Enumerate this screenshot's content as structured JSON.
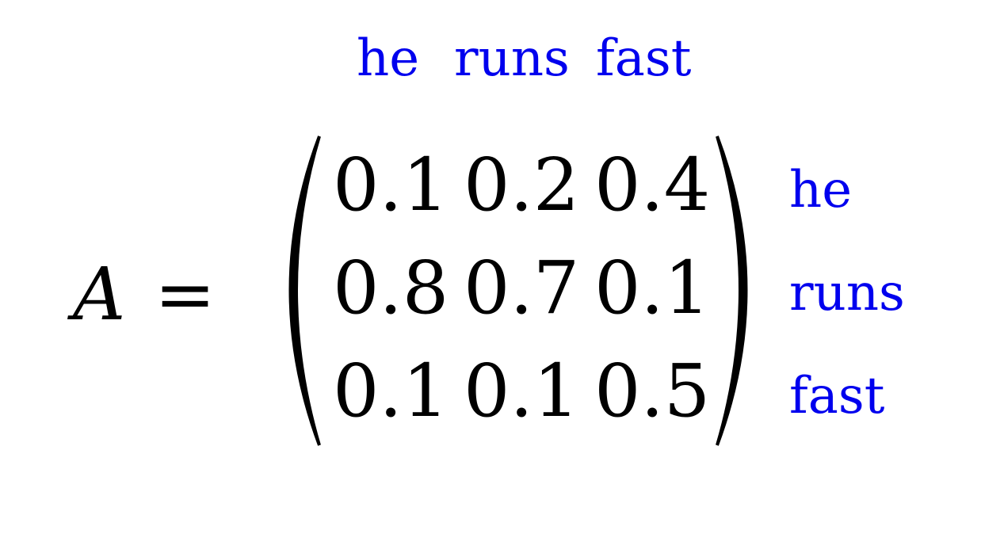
{
  "matrix_name": "A",
  "equals": "=",
  "column_labels": [
    "he",
    "runs",
    "fast"
  ],
  "row_labels": [
    "he",
    "runs",
    "fast"
  ],
  "rows": [
    [
      "0.1",
      "0.2",
      "0.4"
    ],
    [
      "0.8",
      "0.7",
      "0.1"
    ],
    [
      "0.1",
      "0.1",
      "0.5"
    ]
  ],
  "label_color": "#0000ee"
}
